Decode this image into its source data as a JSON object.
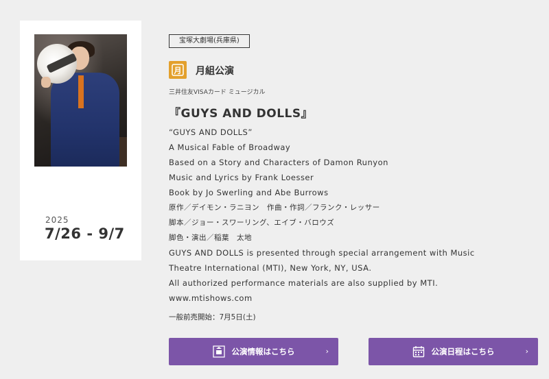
{
  "card": {
    "poster_alt": "月組公演 GUYS AND DOLLS poster",
    "year": "2025",
    "dates": "7/26 - 9/7"
  },
  "venue": "宝塚大劇場(兵庫県)",
  "troupe": {
    "name": "月組公演",
    "logo_glyph": "月",
    "logo_color": "#e3a02d"
  },
  "sponsor": "三井住友VISAカード ミュージカル",
  "title": "『GUYS AND DOLLS』",
  "credits": [
    "“GUYS AND DOLLS”",
    "A Musical Fable of Broadway",
    "Based on a Story and Characters of Damon Runyon",
    "Music and Lyrics by Frank Loesser",
    "Book by Jo Swerling and Abe Burrows",
    "原作／デイモン・ラニヨン　作曲・作詞／フランク・レッサー",
    "脚本／ジョー・スワーリング、エイブ・バロウズ",
    "脚色・演出／稲葉　太地",
    "GUYS AND DOLLS is presented through special arrangement with Music",
    "Theatre International (MTI), New York, NY, USA.",
    "All authorized performance materials are also supplied by MTI.",
    "www.mtishows.com"
  ],
  "presale": "一般前売開始：7月5日(土)",
  "buttons": {
    "info": {
      "label": "公演情報はこちら",
      "icon": "info-icon"
    },
    "schedule": {
      "label": "公演日程はこちら",
      "icon": "calendar-icon"
    }
  },
  "colors": {
    "button_bg": "#7c55a8",
    "page_bg": "#efefef"
  }
}
